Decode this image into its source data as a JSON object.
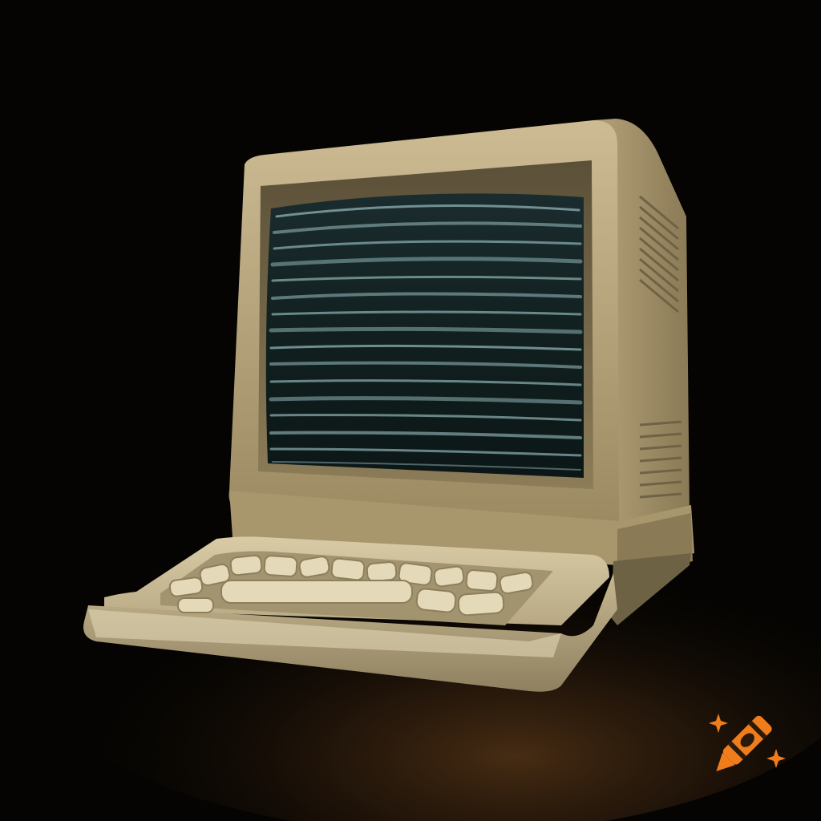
{
  "scene": {
    "subject": "retro-computer",
    "palette": {
      "background": "#050402",
      "desk_glow": "#3a2410",
      "case_light": "#c9b78f",
      "case_mid": "#a8966d",
      "case_shadow": "#6e6245",
      "screen_dark": "#0d1a1d",
      "screen_line": "#8fb3b5",
      "key": "#e4d9b8"
    }
  },
  "watermark": {
    "icon": "crayon-logo-icon",
    "colors": {
      "body": "#f07c1b",
      "band": "#2a1a0c",
      "sparkle": "#f07c1b"
    }
  }
}
